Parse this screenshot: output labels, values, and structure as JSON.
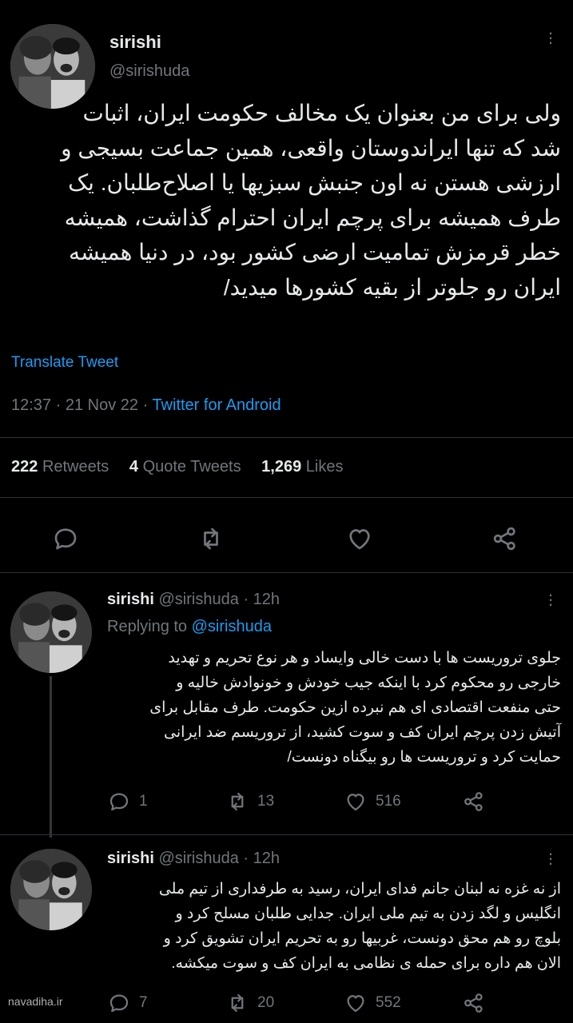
{
  "main_tweet": {
    "display_name": "sirishi",
    "handle": "@sirishuda",
    "text_lines": [
      "ولی برای من بعنوان یک مخالف حکومت ایران، اثبات",
      "شد که تنها ایراندوستان واقعی، همین جماعت بسیجی و",
      "ارزشی هستن نه اون جنبش سبزیها یا اصلاح‌طلبان. یک",
      "طرف همیشه برای پرچم ایران احترام گذاشت، همیشه",
      "خطر قرمزش تمامیت ارضی کشور بود، در دنیا همیشه",
      "ایران رو جلوتر از بقیه کشورها میدید/"
    ],
    "translate_label": "Translate Tweet",
    "time": "12:37",
    "date": "21 Nov 22",
    "source": "Twitter for Android",
    "stats": {
      "retweets_count": "222",
      "retweets_label": "Retweets",
      "quotes_count": "4",
      "quotes_label": "Quote Tweets",
      "likes_count": "1,269",
      "likes_label": "Likes"
    }
  },
  "replies": [
    {
      "display_name": "sirishi",
      "handle": "@sirishuda",
      "time": "12h",
      "replying_prefix": "Replying to",
      "replying_handle": "@sirishuda",
      "text_lines": [
        "جلوی تروریست ها با دست خالی وایساد و هر نوع تحریم و تهدید",
        "خارجی رو محکوم کرد با اینکه جیب خودش و خونوادش خالیه و",
        "حتی منفعت اقتصادی ای هم نبرده ازین حکومت. طرف مقابل برای",
        "آتیش زدن پرچم ایران کف و سوت کشید، از تروریسم ضد ایرانی",
        "حمایت کرد و تروریست ها رو بیگناه دونست/"
      ],
      "replies_count": "1",
      "retweets_count": "13",
      "likes_count": "516"
    },
    {
      "display_name": "sirishi",
      "handle": "@sirishuda",
      "time": "12h",
      "text_lines": [
        "از نه غزه نه لبنان جانم فدای ایران، رسید به طرفداری از تیم ملی",
        "انگلیس و لگد زدن به تیم ملی ایران. جدایی طلبان مسلح کرد و",
        "بلوچ رو هم محق دونست، غربیها رو به تحریم ایران تشویق کرد و",
        "الان هم داره برای حمله ی نظامی به ایران کف و سوت میکشه."
      ],
      "replies_count": "7",
      "retweets_count": "20",
      "likes_count": "552"
    }
  ],
  "watermark": "navadiha.ir",
  "colors": {
    "background": "#000000",
    "text": "#e7e9ea",
    "muted": "#71767b",
    "link": "#1d9bf0",
    "divider": "#2f3336"
  }
}
